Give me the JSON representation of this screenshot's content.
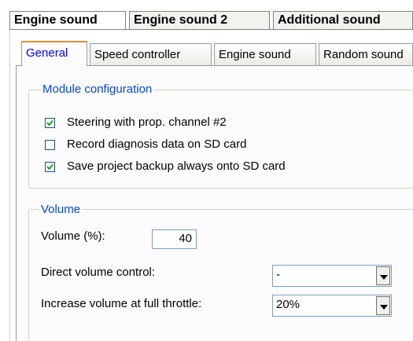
{
  "outer_tabs": [
    {
      "label": "Engine sound"
    },
    {
      "label": "Engine sound 2"
    },
    {
      "label": "Additional sound"
    }
  ],
  "inner_tabs": [
    {
      "label": "General"
    },
    {
      "label": "Speed controller"
    },
    {
      "label": "Engine sound"
    },
    {
      "label": "Random sound"
    }
  ],
  "module_configuration": {
    "legend": "Module configuration",
    "options": [
      {
        "label": "Steering with prop. channel #2",
        "checked": true
      },
      {
        "label": "Record diagnosis data on SD card",
        "checked": false
      },
      {
        "label": "Save project backup always onto SD card",
        "checked": true
      }
    ]
  },
  "volume": {
    "legend": "Volume",
    "volume_label": "Volume (%):",
    "volume_value": "40",
    "direct_label": "Direct volume control:",
    "direct_value": "-",
    "increase_label": "Increase volume at full throttle:",
    "increase_value": "20%"
  },
  "colors": {
    "legend_text": "#0046d5",
    "active_tab_text": "#0000ff",
    "active_tab_accent": "#e68b2c"
  }
}
